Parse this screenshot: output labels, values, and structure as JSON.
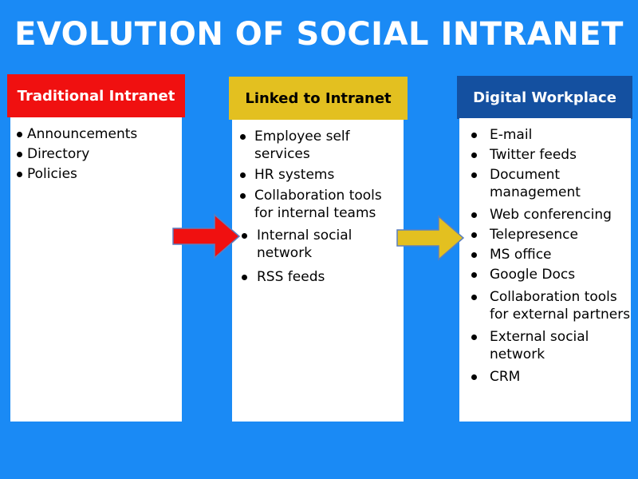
{
  "title": "EVOLUTION OF SOCIAL INTRANET",
  "colors": {
    "background": "#1a8af5",
    "traditional": "#f01010",
    "linked": "#e3c020",
    "digital": "#1450a0"
  },
  "columns": [
    {
      "heading": "Traditional Intranet",
      "items": [
        "Announcements",
        "Directory",
        "Policies"
      ]
    },
    {
      "heading": "Linked to Intranet",
      "items": [
        "Employee self services",
        "HR systems",
        "Collaboration tools for internal teams",
        "Internal social network",
        "RSS feeds"
      ]
    },
    {
      "heading": "Digital Workplace",
      "items": [
        "E-mail",
        "Twitter feeds",
        "Document management",
        "Web conferencing",
        "Telepresence",
        "MS office",
        "Google Docs",
        "Collaboration tools for external partners",
        "External social network",
        "CRM"
      ]
    }
  ],
  "arrows": [
    {
      "from": "Traditional Intranet",
      "to": "Linked to Intranet",
      "color": "#f01010"
    },
    {
      "from": "Linked to Intranet",
      "to": "Digital Workplace",
      "color": "#e3c020"
    }
  ]
}
